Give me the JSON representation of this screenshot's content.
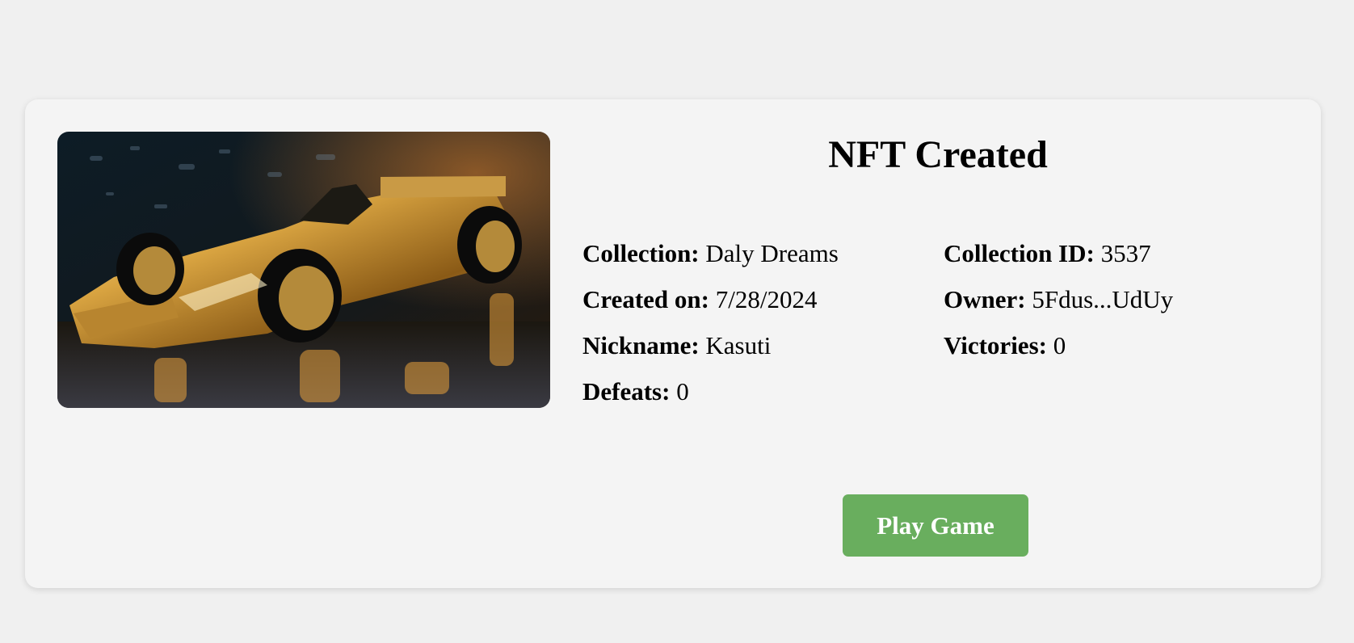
{
  "card": {
    "title": "NFT Created",
    "image": {
      "subject": "golden race car",
      "accent": "#d9a441"
    },
    "details": [
      {
        "label": "Collection:",
        "value": "Daly Dreams"
      },
      {
        "label": "Collection ID:",
        "value": "3537"
      },
      {
        "label": "Created on:",
        "value": "7/28/2024"
      },
      {
        "label": "Owner:",
        "value": "5Fdus...UdUy"
      },
      {
        "label": "Nickname:",
        "value": "Kasuti"
      },
      {
        "label": "Victories:",
        "value": "0"
      },
      {
        "label": "Defeats:",
        "value": "0"
      }
    ],
    "play_button_label": "Play Game",
    "play_button_color": "#69ae5e"
  }
}
